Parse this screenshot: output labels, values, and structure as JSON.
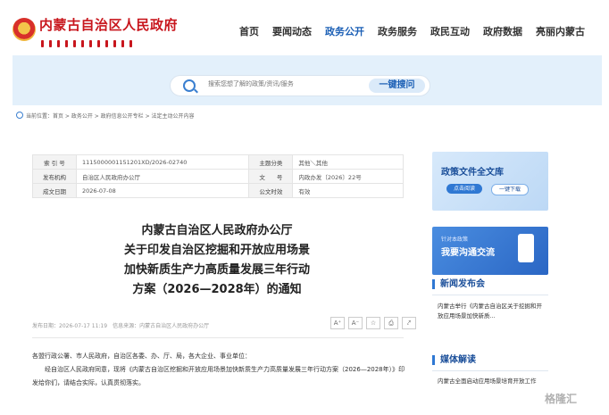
{
  "header": {
    "site_title": "内蒙古自治区人民政府",
    "nav": [
      "首页",
      "要闻动态",
      "政务公开",
      "政务服务",
      "政民互动",
      "政府数据",
      "亮丽内蒙古"
    ],
    "active_nav": "政务公开"
  },
  "search": {
    "placeholder": "搜索您想了解的政策/资讯/服务",
    "button_label": "一键搜问"
  },
  "breadcrumb": "当前位置：首页 > 政务公开 > 政府信息公开专栏 > 法定主动公开内容",
  "info": {
    "rows": [
      [
        "索 引 号",
        "11150000011512​01XD/2026-02740",
        "主题分类",
        "其他＼其他"
      ],
      [
        "发布机构",
        "自治区人民政府办公厅",
        "文　　号",
        "内政办发〔2026〕22号"
      ],
      [
        "成文日期",
        "2026-07-08",
        "公文时效",
        "有效"
      ]
    ]
  },
  "doc": {
    "title_lines": [
      "内蒙古自治区人民政府办公厅",
      "关于印发自治区挖掘和开放应用场景",
      "加快新质生产力高质量发展三年行动",
      "方案（2026—2028年）的通知"
    ],
    "meta": "发布日期：2026-07-17 11:19　信息来源：内蒙古自治区人民政府办公厅",
    "tools": [
      "A⁺",
      "A⁻",
      "☆",
      "⎙",
      "⤤"
    ],
    "body_line1": "各盟行政公署、市人民政府，自治区各委、办、厅、局，各大企业、事业单位：",
    "body_line2": "　　经自治区人民政府同意，现将《内蒙古自治区挖掘和开放应用场景加快新质生产力高质量发展三年行动方案（2026—2028年）》印发给你们，请结合实际，认真贯彻落实。"
  },
  "side": {
    "card1_title": "政策文件全文库",
    "card1_btn1": "点击阅读",
    "card1_btn2": "一键下载",
    "card2_small": "针对本政策",
    "card2_big": "我要沟通交流",
    "sec1_title": "新闻发布会",
    "sec1_text": "内蒙古举行《内蒙古自治区关于挖掘和开放应用场景加快新质...",
    "sec2_title": "媒体解读",
    "sec2_text": "内蒙古全面启动应用场景培育开放工作"
  },
  "watermark": "格隆汇",
  "colors": {
    "brand_red": "#c8161d",
    "accent_blue": "#1b5fb5",
    "band": "#e3f0fb"
  }
}
